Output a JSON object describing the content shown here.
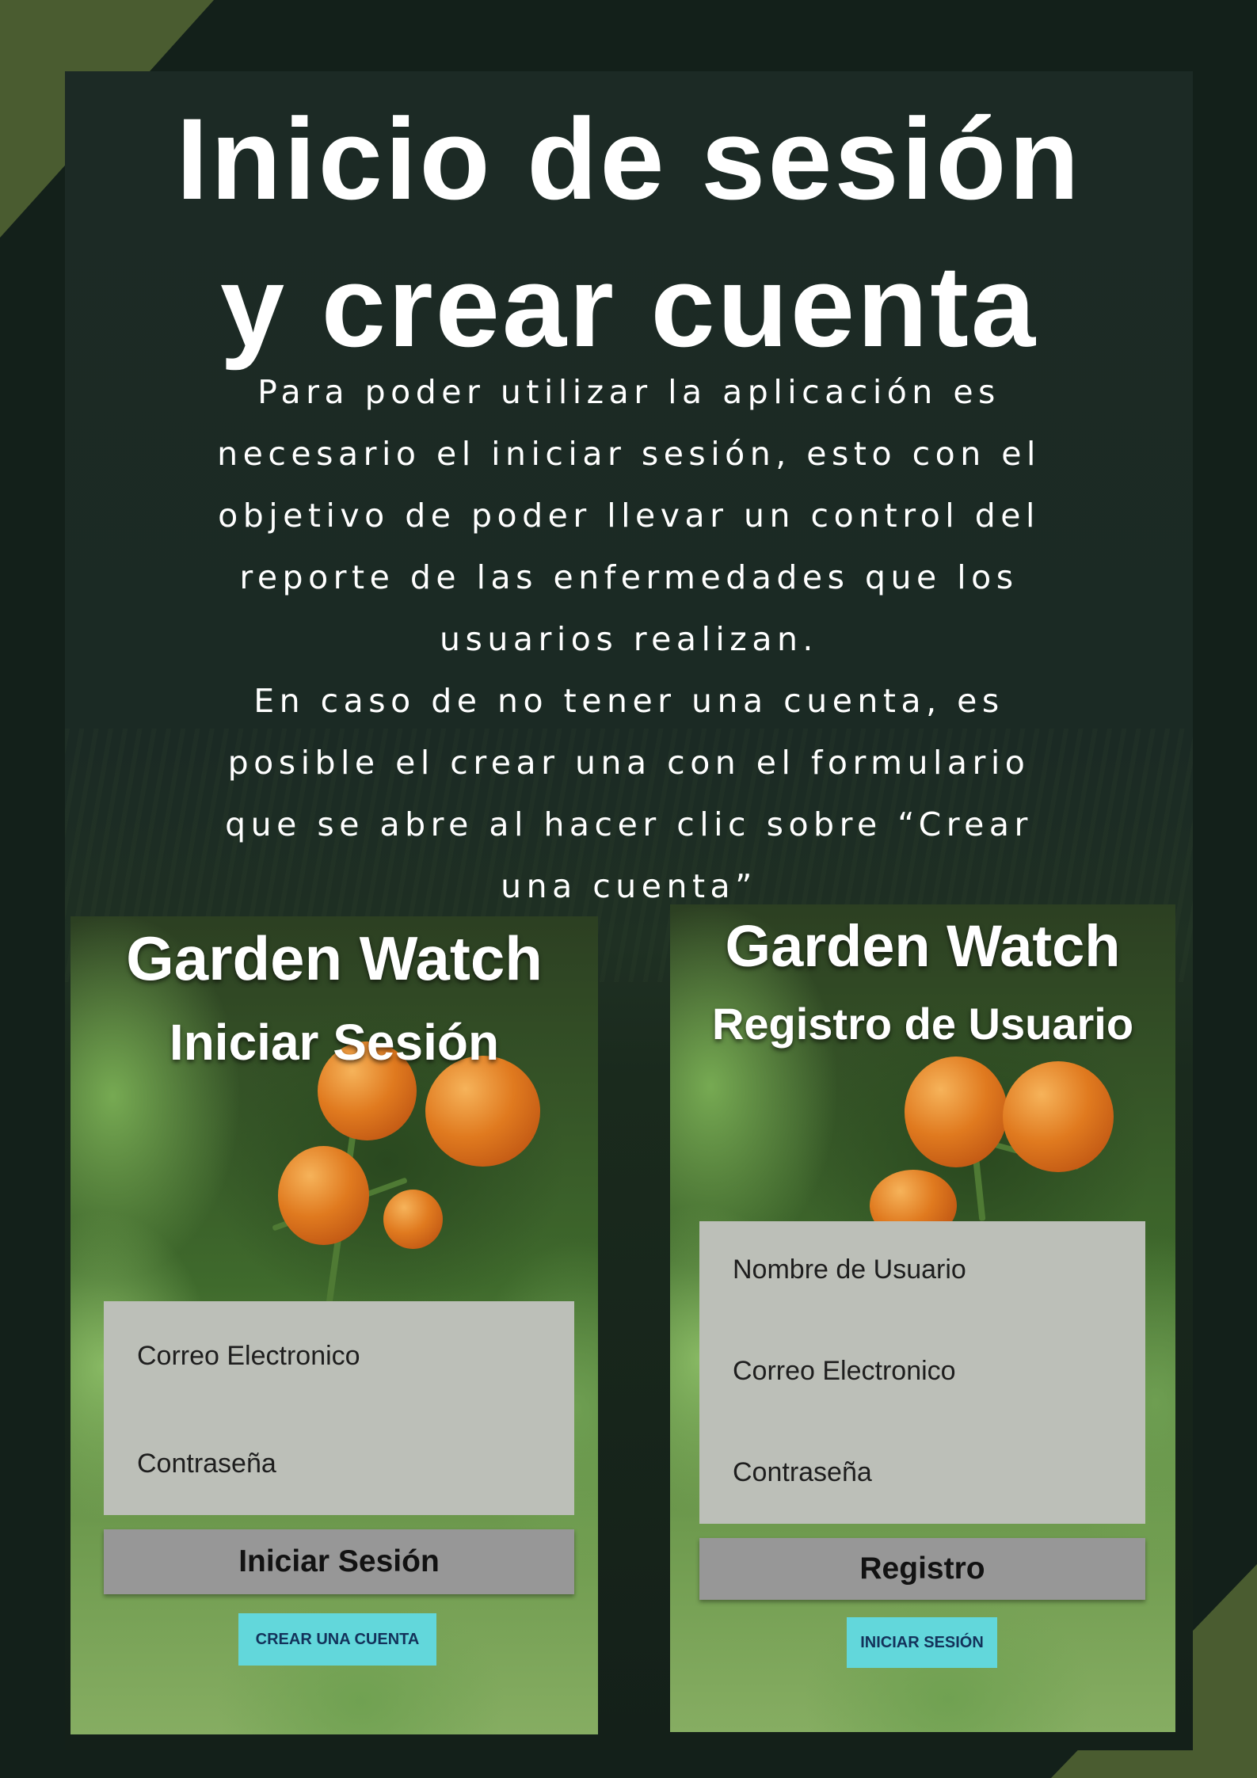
{
  "colors": {
    "background": "#13201a",
    "accent_corner": "#4a5c30",
    "form_box": "#bcbfb8",
    "main_button": "#979797",
    "link_button": "#62d7db"
  },
  "header": {
    "title_line1": "Inicio de sesión",
    "title_line2": "y crear cuenta"
  },
  "description": {
    "lines": [
      "Para poder utilizar la aplicación es",
      "necesario el iniciar sesión, esto con el",
      "objetivo de poder llevar un control del",
      "reporte de las enfermedades que los",
      "usuarios realizan.",
      "En caso de no tener una cuenta, es",
      "posible el crear una con el formulario",
      "que se abre al hacer clic sobre “Crear",
      "una cuenta”"
    ]
  },
  "login_screen": {
    "app_name": "Garden Watch",
    "heading": "Iniciar Sesión",
    "email_placeholder": "Correo Electronico",
    "password_placeholder": "Contraseña",
    "submit_label": "Iniciar Sesión",
    "create_account_label": "CREAR UNA CUENTA"
  },
  "register_screen": {
    "app_name": "Garden Watch",
    "heading": "Registro de Usuario",
    "username_placeholder": "Nombre de Usuario",
    "email_placeholder": "Correo Electronico",
    "password_placeholder": "Contraseña",
    "submit_label": "Registro",
    "login_label": "INICIAR SESIÓN"
  }
}
